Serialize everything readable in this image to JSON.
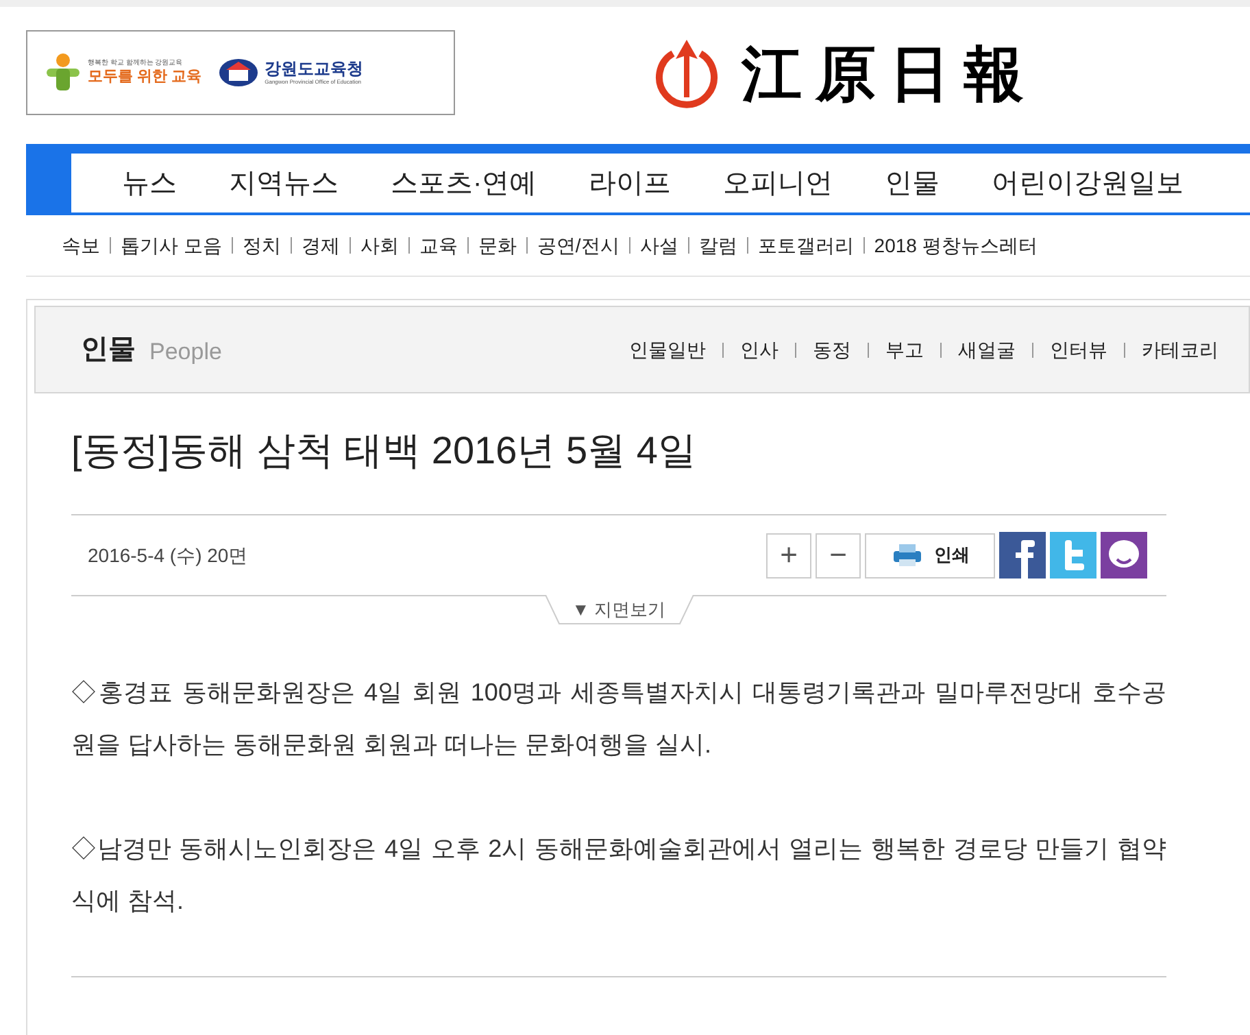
{
  "ad_banner": {
    "slogan": "행복한 학교 함께하는 강원교육",
    "motto": "모두를 위한 교육",
    "office": "강원도교육청",
    "office_en": "Gangwon Provincial Office of Education"
  },
  "masthead": {
    "title": "江原日報"
  },
  "main_nav": [
    "뉴스",
    "지역뉴스",
    "스포츠·연예",
    "라이프",
    "오피니언",
    "인물",
    "어린이강원일보"
  ],
  "sub_nav": [
    "속보",
    "톱기사 모음",
    "정치",
    "경제",
    "사회",
    "교육",
    "문화",
    "공연/전시",
    "사설",
    "칼럼",
    "포토갤러리",
    "2018 평창뉴스레터"
  ],
  "section": {
    "title": "인물",
    "subtitle": "People",
    "links": [
      "인물일반",
      "인사",
      "동정",
      "부고",
      "새얼굴",
      "인터뷰",
      "카테코리"
    ]
  },
  "article": {
    "headline": "[동정]동해 삼척 태백 2016년 5월 4일",
    "meta": "2016-5-4 (수) 20면",
    "tools": [
      {
        "kind": "text",
        "label": "+"
      },
      {
        "kind": "text",
        "label": "−"
      },
      {
        "kind": "print",
        "label": "인쇄"
      },
      {
        "kind": "facebook"
      },
      {
        "kind": "twitter"
      },
      {
        "kind": "talk"
      }
    ],
    "page_view": "▼ 지면보기",
    "paragraphs": [
      "◇홍경표 동해문화원장은 4일 회원 100명과 세종특별자치시 대통령기록관과 밀마루전망대 호수공원을 답사하는 동해문화원 회원과 떠나는 문화여행을 실시.",
      "◇남경만 동해시노인회장은 4일 오후 2시 동해문화예술회관에서 열리는 행복한 경로당 만들기 협약식에 참석."
    ]
  }
}
